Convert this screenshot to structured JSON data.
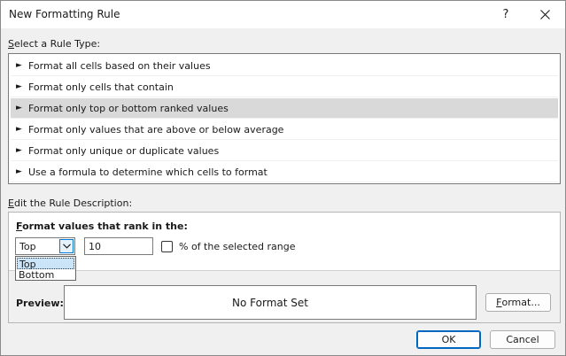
{
  "window": {
    "title": "New Formatting Rule",
    "help_glyph": "?",
    "close_glyph": "✕"
  },
  "rule_type": {
    "label": "Select a Rule Type:",
    "label_mnemonic": "S",
    "label_rest": "elect a Rule Type:",
    "arrow_glyph": "►",
    "items": [
      "Format all cells based on their values",
      "Format only cells that contain",
      "Format only top or bottom ranked values",
      "Format only values that are above or below average",
      "Format only unique or duplicate values",
      "Use a formula to determine which cells to format"
    ],
    "selected_index": 2
  },
  "description": {
    "label": "Edit the Rule Description:",
    "label_mnemonic": "E",
    "label_rest": "dit the Rule Description:",
    "rank_label": "Format values that rank in the:",
    "rank_label_mnemonic": "F",
    "rank_label_rest": "ormat values that rank in the:",
    "rank_select": {
      "value": "Top",
      "options": [
        "Top",
        "Bottom"
      ],
      "highlighted_index": 0
    },
    "rank_count": "10",
    "percent_checkbox": {
      "label": "% of the selected range",
      "checked": false
    },
    "preview": {
      "label": "Preview:",
      "text": "No Format Set"
    },
    "format_button": "Format...",
    "format_button_mnemonic": "F",
    "format_button_rest": "ormat..."
  },
  "buttons": {
    "ok": "OK",
    "cancel": "Cancel"
  },
  "colors": {
    "selected_row": "#d9d9d9",
    "dropdown_highlight": "#cce4f7",
    "accent": "#0067c0"
  }
}
